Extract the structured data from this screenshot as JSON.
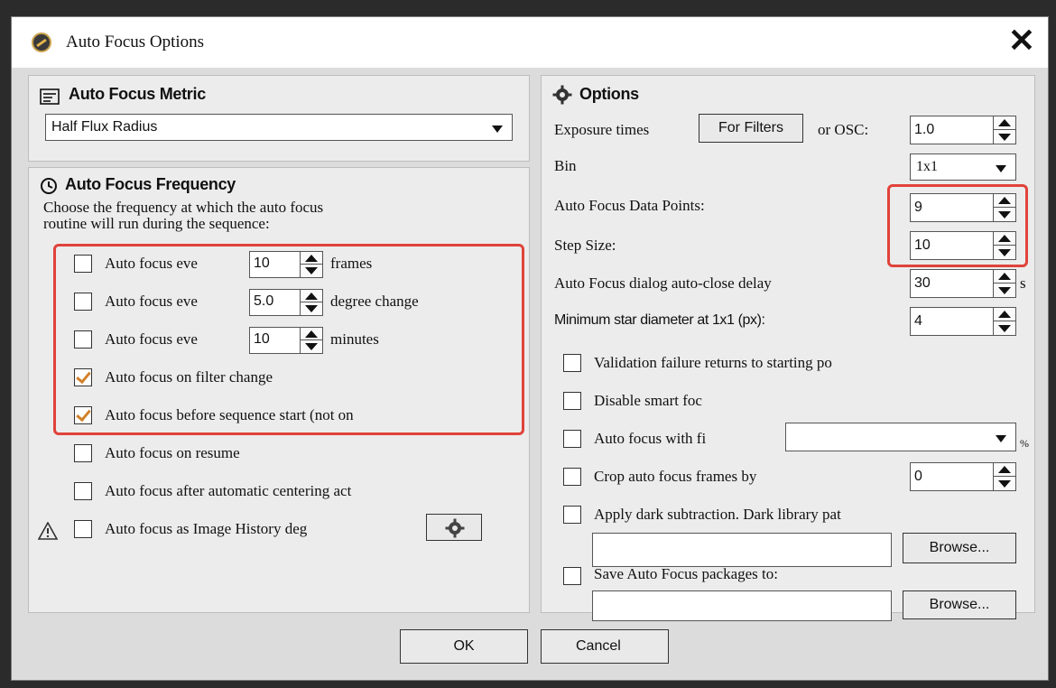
{
  "window": {
    "title": "Auto Focus Options",
    "close_label": "✕"
  },
  "metric": {
    "heading": "Auto Focus Metric",
    "selected": "Half Flux Radius"
  },
  "frequency": {
    "heading": "Auto Focus Frequency",
    "description_1": "Choose the frequency at which the auto focus",
    "description_2": "routine will run during the sequence:",
    "items": [
      {
        "prefix": "Auto focus eve",
        "value": "10",
        "suffix": "frames",
        "checked": false
      },
      {
        "prefix": "Auto focus eve",
        "value": "5.0",
        "suffix": "degree change",
        "checked": false
      },
      {
        "prefix": "Auto focus eve",
        "value": "10",
        "suffix": "minutes",
        "checked": false
      },
      {
        "label": "Auto focus on filter change",
        "checked": true
      },
      {
        "label": "Auto focus before sequence start (not on",
        "checked": true
      },
      {
        "label": "Auto focus on resume",
        "checked": false
      },
      {
        "label": "Auto focus after automatic centering act",
        "checked": false
      },
      {
        "label": "Auto focus as Image History deg",
        "checked": false
      }
    ]
  },
  "options": {
    "heading": "Options",
    "exposure_label": "Exposure times",
    "for_filters_button": "For Filters",
    "or_osc_label": "or OSC:",
    "exposure_value": "1.0",
    "bin_label": "Bin",
    "bin_value": "1x1",
    "data_points_label": "Auto Focus Data Points:",
    "data_points_value": "9",
    "step_size_label": "Step Size:",
    "step_size_value": "10",
    "autoclose_label": "Auto Focus dialog auto-close delay",
    "autoclose_value": "30",
    "autoclose_unit": "s",
    "min_star_label": "Minimum star diameter at 1x1 (px):",
    "min_star_value": "4",
    "validation_label": "Validation failure returns to starting po",
    "disable_smart_label": "Disable smart foc",
    "af_with_filter_label": "Auto focus with fi",
    "af_with_filter_unit": "%",
    "crop_label": "Crop auto focus frames by",
    "crop_value": "0",
    "dark_sub_label": "Apply dark subtraction.  Dark library pat",
    "browse_1": "Browse...",
    "save_packages_label": "Save Auto Focus packages to:",
    "browse_2": "Browse..."
  },
  "footer": {
    "ok": "OK",
    "cancel": "Cancel"
  }
}
